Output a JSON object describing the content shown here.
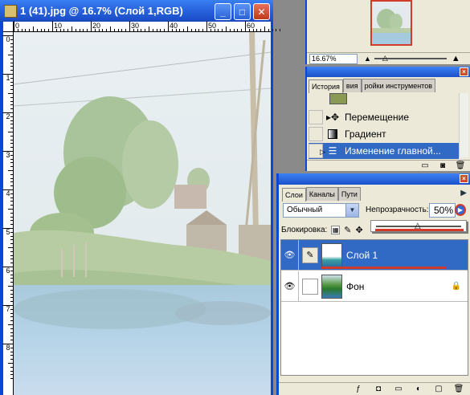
{
  "document": {
    "title": "1 (41).jpg @ 16.7% (Слой 1,RGB)",
    "ruler_h_labels": [
      "0",
      "10",
      "20",
      "30",
      "40",
      "50",
      "60"
    ],
    "ruler_v_labels": [
      "0",
      "1",
      "2",
      "3",
      "4",
      "5",
      "6",
      "7",
      "8"
    ]
  },
  "navigator": {
    "zoom_value": "16.67%"
  },
  "history": {
    "tabs": [
      "История",
      "вия",
      "ройки инструментов"
    ],
    "items": [
      {
        "label": "Перемещение",
        "icon": "move-icon",
        "selected": false
      },
      {
        "label": "Градиент",
        "icon": "gradient-icon",
        "selected": false
      },
      {
        "label": "Изменение главной...",
        "icon": "layer-change-icon",
        "selected": true
      }
    ]
  },
  "layers": {
    "tabs": [
      "Слои",
      "Каналы",
      "Пути"
    ],
    "blend_mode": "Обычный",
    "opacity_label": "Непрозрачность:",
    "opacity_value": "50%",
    "lock_label": "Блокировка:",
    "items": [
      {
        "name": "Слой 1",
        "selected": true
      },
      {
        "name": "Фон",
        "selected": false
      }
    ]
  },
  "colors": {
    "xp_blue": "#0a46d8",
    "selection": "#316ac5",
    "highlight_red": "#d23a2a"
  }
}
